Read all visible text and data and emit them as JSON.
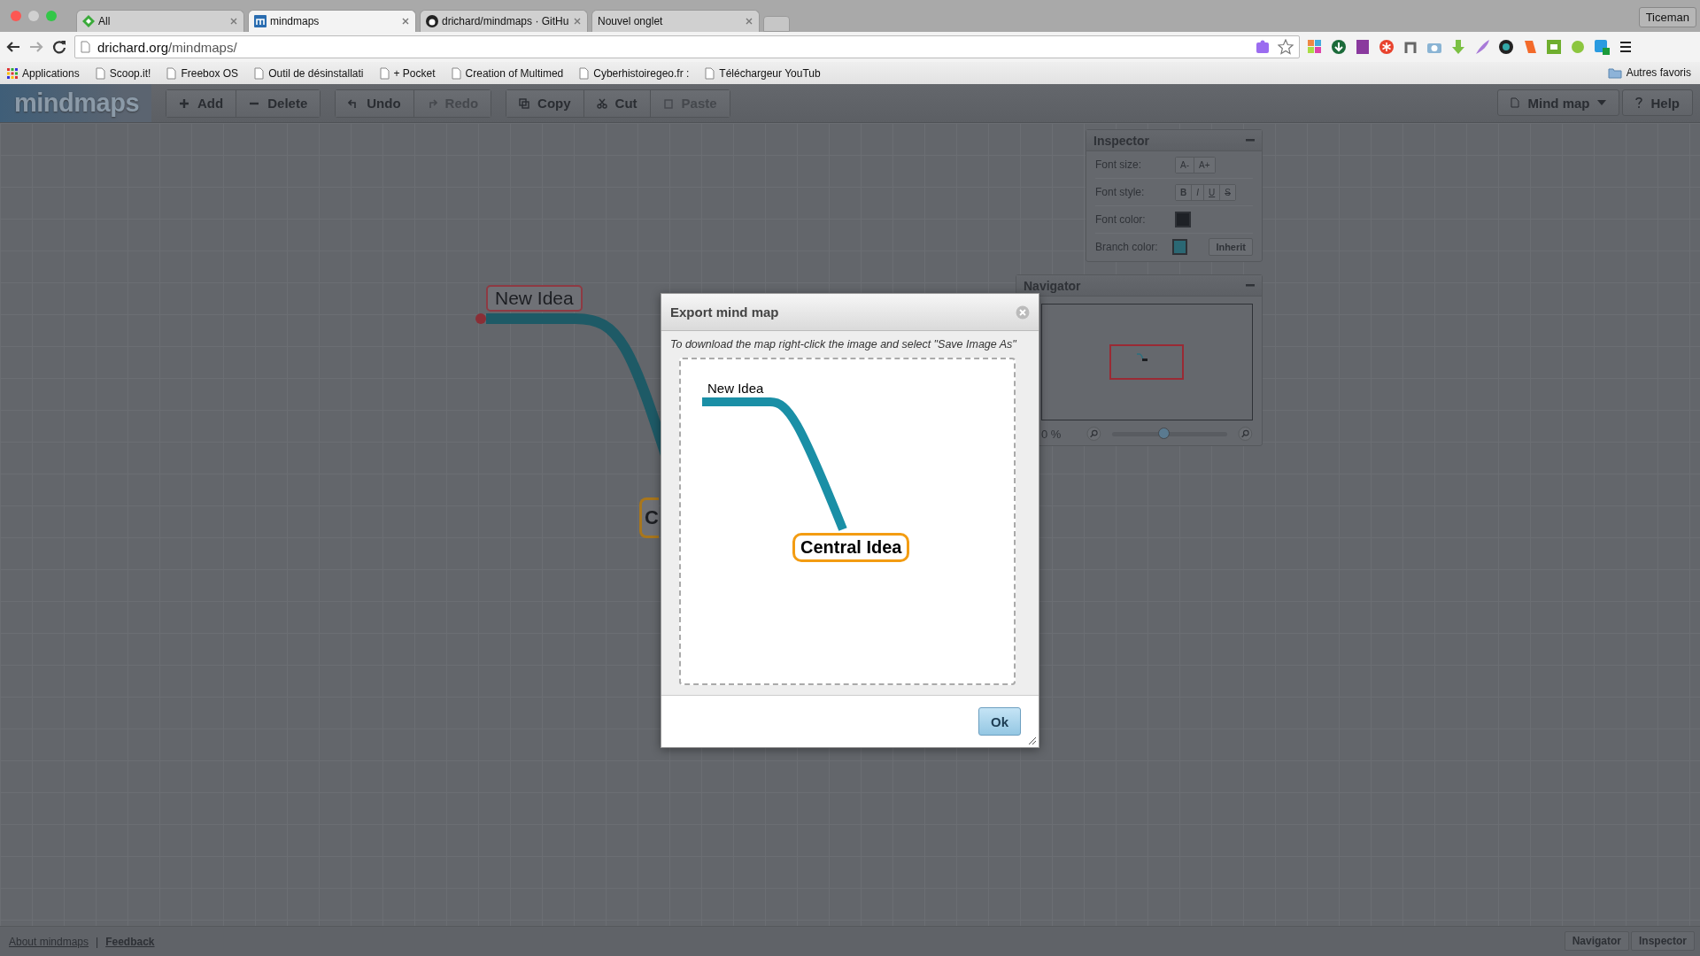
{
  "browser": {
    "tabs": [
      {
        "title": "All",
        "selected": false
      },
      {
        "title": "mindmaps",
        "selected": true
      },
      {
        "title": "drichard/mindmaps · GitHu",
        "selected": false
      },
      {
        "title": "Nouvel onglet",
        "selected": false
      }
    ],
    "profile": "Ticeman",
    "address": {
      "host": "drichard.org",
      "path": "/mindmaps/"
    },
    "bookmarks": [
      "Applications",
      "Scoop.it!",
      "Freebox OS",
      "Outil de désinstallati",
      "+ Pocket",
      "Creation of Multimed",
      "Cyberhistoiregeo.fr :",
      "Téléchargeur YouTub"
    ],
    "other_bookmarks": "Autres favoris"
  },
  "app": {
    "logo": "mindmaps",
    "toolbar": [
      [
        {
          "label": "Add",
          "disabled": false
        },
        {
          "label": "Delete",
          "disabled": false
        }
      ],
      [
        {
          "label": "Undo",
          "disabled": false
        },
        {
          "label": "Redo",
          "disabled": true
        }
      ],
      [
        {
          "label": "Copy",
          "disabled": false
        },
        {
          "label": "Cut",
          "disabled": false
        },
        {
          "label": "Paste",
          "disabled": true
        }
      ]
    ],
    "menu": [
      {
        "label": "Mind map",
        "kind": "dropdown"
      },
      {
        "label": "Help",
        "kind": "help"
      }
    ]
  },
  "canvas": {
    "nodes": [
      {
        "text": "New Idea",
        "kind": "child",
        "color": "#8e3a43"
      },
      {
        "text": "C",
        "kind": "root",
        "color": "#a8761c"
      }
    ]
  },
  "inspector": {
    "title": "Inspector",
    "font_size": {
      "label": "Font size:",
      "buttons": [
        "A-",
        "A+"
      ]
    },
    "font_style": {
      "label": "Font style:",
      "buttons": [
        "B",
        "I",
        "U",
        "S"
      ]
    },
    "font_color": {
      "label": "Font color:",
      "color": "#1e2126"
    },
    "branch_color": {
      "label": "Branch color:",
      "color": "#2b6874",
      "button": "Inherit"
    }
  },
  "navigator": {
    "title": "Navigator",
    "zoom": "0 %",
    "slider": {
      "level": 0.45
    }
  },
  "dialog": {
    "title": "Export mind map",
    "hint": "To download the map right-click the image and select \"Save Image As\"",
    "preview": {
      "child": "New Idea",
      "root": "Central Idea"
    },
    "button": "Ok"
  },
  "footer": {
    "links": [
      "About mindmaps",
      "Feedback"
    ],
    "separator": "|",
    "buttons": [
      "Navigator",
      "Inspector"
    ]
  }
}
